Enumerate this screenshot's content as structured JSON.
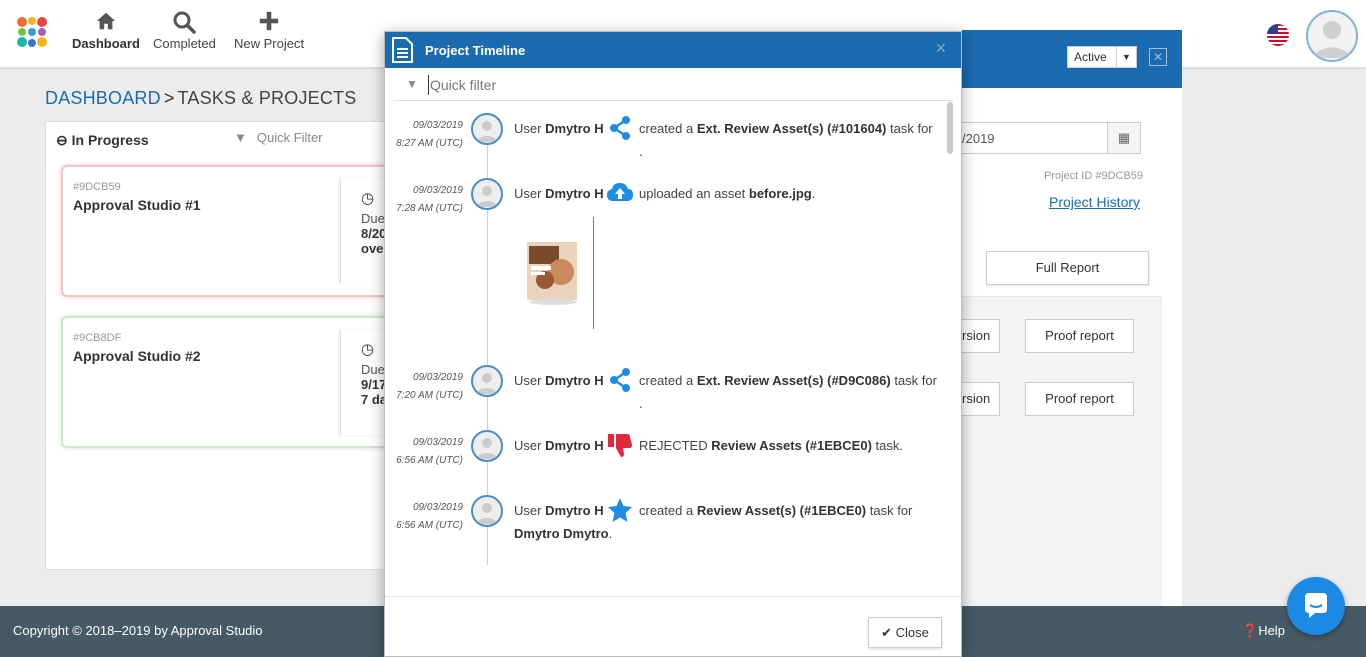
{
  "nav": {
    "items": [
      {
        "label": "Dashboard",
        "icon": "home-icon"
      },
      {
        "label": "Completed",
        "icon": "search-icon"
      },
      {
        "label": "New Project",
        "icon": "plus-icon"
      }
    ]
  },
  "breadcrumb": {
    "home": "DASHBOARD",
    "separator": ">",
    "current": "TASKS & PROJECTS"
  },
  "panel": {
    "heading": "In Progress",
    "filter_placeholder": "Quick Filter",
    "cards": [
      {
        "id": "#9DCB59",
        "title": "Approval Studio #1",
        "due_label": "Due",
        "due_date": "8/20",
        "due_status": "over"
      },
      {
        "id": "#9CB8DF",
        "title": "Approval Studio #2",
        "due_label": "Due",
        "due_date": "9/17",
        "due_status": "7 da"
      }
    ]
  },
  "right_panel": {
    "status": "Active",
    "date_value": "/2019",
    "project_id": "Project ID #9DCB59",
    "project_history": "Project History",
    "full_report": "Full Report",
    "version_label": "rsion",
    "proof_report": "Proof report"
  },
  "modal": {
    "title": "Project Timeline",
    "filter_placeholder": "Quick filter",
    "close_label": "Close",
    "entries": [
      {
        "date": "09/03/2019",
        "time": "8:27 AM (UTC)",
        "user_prefix": "User",
        "user": "Dmytro H",
        "icon": "share-icon",
        "action": "created a",
        "object": "Ext. Review Asset(s) (#101604)",
        "suffix": "task for ."
      },
      {
        "date": "09/03/2019",
        "time": "7:28 AM (UTC)",
        "user_prefix": "User",
        "user": "Dmytro H",
        "icon": "cloud-upload-icon",
        "action": "uploaded an asset",
        "object": "before.jpg",
        "suffix": "."
      },
      {
        "date": "09/03/2019",
        "time": "7:20 AM (UTC)",
        "user_prefix": "User",
        "user": "Dmytro H",
        "icon": "share-icon",
        "action": "created a",
        "object": "Ext. Review Asset(s) (#D9C086)",
        "suffix": "task for ."
      },
      {
        "date": "09/03/2019",
        "time": "6:56 AM (UTC)",
        "user_prefix": "User",
        "user": "Dmytro H",
        "icon": "thumbs-down-icon",
        "action": "REJECTED",
        "object": "Review Assets (#1EBCE0)",
        "suffix": "task."
      },
      {
        "date": "09/03/2019",
        "time": "6:56 AM (UTC)",
        "user_prefix": "User",
        "user": "Dmytro H",
        "icon": "star-icon",
        "action": "created a",
        "object": "Review Asset(s) (#1EBCE0)",
        "suffix": "task for",
        "object2": "Dmytro Dmytro",
        "suffix2": "."
      }
    ]
  },
  "footer": {
    "copyright": "Copyright © 2018–2019 by Approval Studio",
    "help": "Help"
  },
  "colors": {
    "brand_blue": "#1b6bb0",
    "footer": "#455a64",
    "reject_red": "#e0283c",
    "icon_blue": "#1f8ce6"
  }
}
